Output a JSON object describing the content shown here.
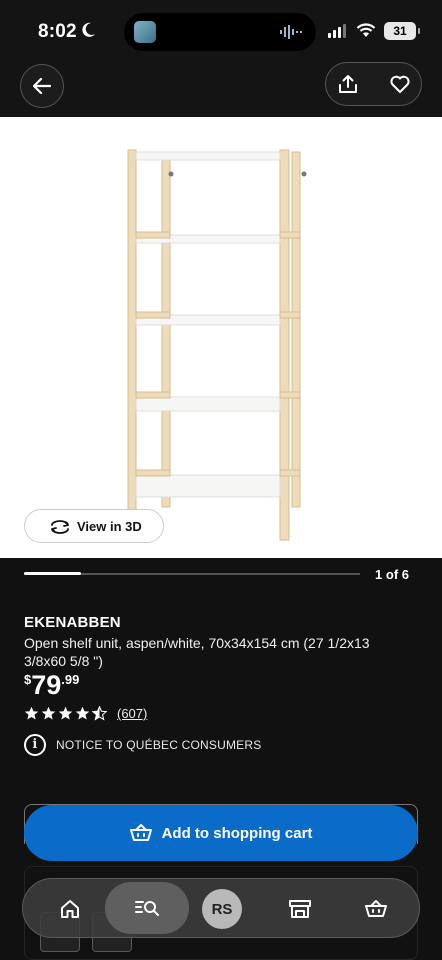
{
  "status_bar": {
    "time": "8:02",
    "battery": "31"
  },
  "nav": {
    "back_icon": "arrow-left-icon",
    "share_icon": "share-icon",
    "favorite_icon": "heart-icon"
  },
  "gallery": {
    "view_3d_label": "View in 3D",
    "page_indicator": "1 of 6",
    "progress": 0.17
  },
  "product": {
    "name": "EKENABBEN",
    "description": "Open shelf unit, aspen/white, 70x34x154 cm (27 1/2x13 3/8x60 5/8 \")",
    "price_currency": "$",
    "price_integer": "79",
    "price_decimal": ".99",
    "rating_stars": 4.5,
    "review_count": "(607)",
    "notice": "NOTICE TO QUÉBEC CONSUMERS"
  },
  "cart": {
    "add_label": "Add to shopping cart",
    "button_color": "#0a6bc9"
  },
  "tabbar": {
    "items": [
      "home-icon",
      "search-list-icon",
      "avatar",
      "store-icon",
      "cart-icon"
    ],
    "avatar_initials": "RS"
  }
}
